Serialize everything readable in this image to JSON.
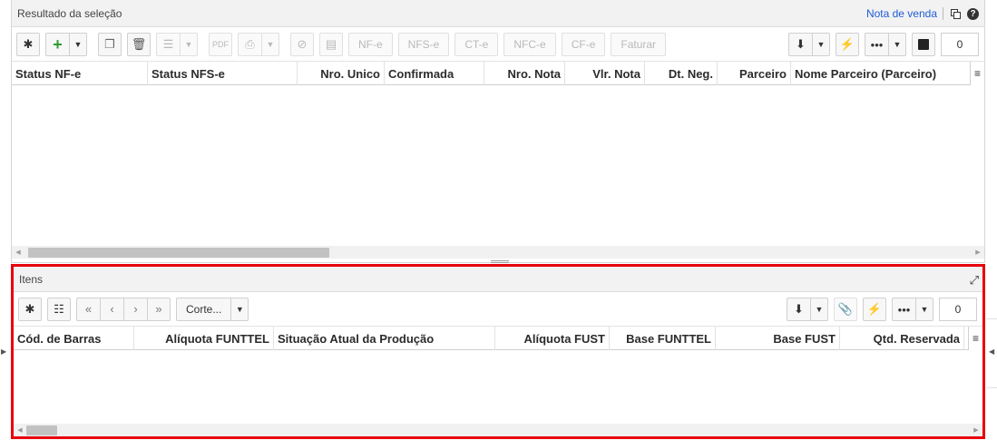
{
  "top_panel": {
    "title": "Resultado da seleção",
    "header_link": "Nota de venda",
    "help": "?",
    "toolbar": {
      "buttons": [
        "NF-e",
        "NFS-e",
        "CT-e",
        "NFC-e",
        "CF-e",
        "Faturar"
      ],
      "count": "0"
    },
    "columns": [
      "Status NF-e",
      "Status NFS-e",
      "Nro. Unico",
      "Confirmada",
      "Nro. Nota",
      "Vlr. Nota",
      "Dt. Neg.",
      "Parceiro",
      "Nome Parceiro (Parceiro)"
    ]
  },
  "bottom_panel": {
    "title": "Itens",
    "toolbar": {
      "nav_first": "«",
      "nav_prev": "‹",
      "nav_next": "›",
      "nav_last": "»",
      "cut_label": "Corte...",
      "count": "0"
    },
    "columns": [
      "Cód. de Barras",
      "Alíquota FUNTTEL",
      "Situação Atual da Produção",
      "Alíquota FUST",
      "Base FUNTTEL",
      "Base FUST",
      "Qtd. Reservada"
    ]
  },
  "colors": {
    "highlight": "#e8000b",
    "link": "#1f5bd6",
    "add": "#2e9b2e"
  },
  "icons": [
    "gear-icon",
    "plus-icon",
    "copy-icon",
    "trash-icon",
    "list-icon",
    "pdf-icon",
    "print-icon",
    "export-icon",
    "bolt-icon",
    "more-icon",
    "bag-icon",
    "clip-icon",
    "expand-icon",
    "popout-icon",
    "help-icon",
    "menu-icon"
  ]
}
